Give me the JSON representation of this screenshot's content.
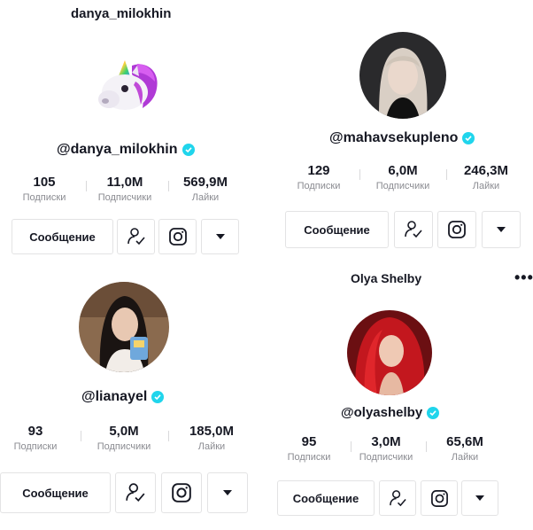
{
  "profiles": [
    {
      "top_username": "danya_milokhin",
      "handle": "@danya_milokhin",
      "avatar": "unicorn-emoji",
      "stats": [
        {
          "value": "105",
          "label": "Подписки"
        },
        {
          "value": "11,0M",
          "label": "Подписчики"
        },
        {
          "value": "569,9M",
          "label": "Лайки"
        }
      ],
      "message_button": "Сообщение"
    },
    {
      "handle": "@mahavsekupleno",
      "avatar": "photo-blonde",
      "stats": [
        {
          "value": "129",
          "label": "Подписки"
        },
        {
          "value": "6,0M",
          "label": "Подписчики"
        },
        {
          "value": "246,3M",
          "label": "Лайки"
        }
      ],
      "message_button": "Сообщение"
    },
    {
      "handle": "@lianayel",
      "avatar": "photo-brunette",
      "stats": [
        {
          "value": "93",
          "label": "Подписки"
        },
        {
          "value": "5,0M",
          "label": "Подписчики"
        },
        {
          "value": "185,0M",
          "label": "Лайки"
        }
      ],
      "message_button": "Сообщение"
    },
    {
      "top_username": "Olya Shelby",
      "handle": "@olyashelby",
      "avatar": "photo-redhead",
      "more_icon": "•••",
      "stats": [
        {
          "value": "95",
          "label": "Подписки"
        },
        {
          "value": "3,0M",
          "label": "Подписчики"
        },
        {
          "value": "65,6M",
          "label": "Лайки"
        }
      ],
      "message_button": "Сообщение"
    }
  ],
  "colors": {
    "verified": "#20d5ec",
    "text": "#161823",
    "secondary": "#8a8b91",
    "border": "#e3e3e4"
  }
}
